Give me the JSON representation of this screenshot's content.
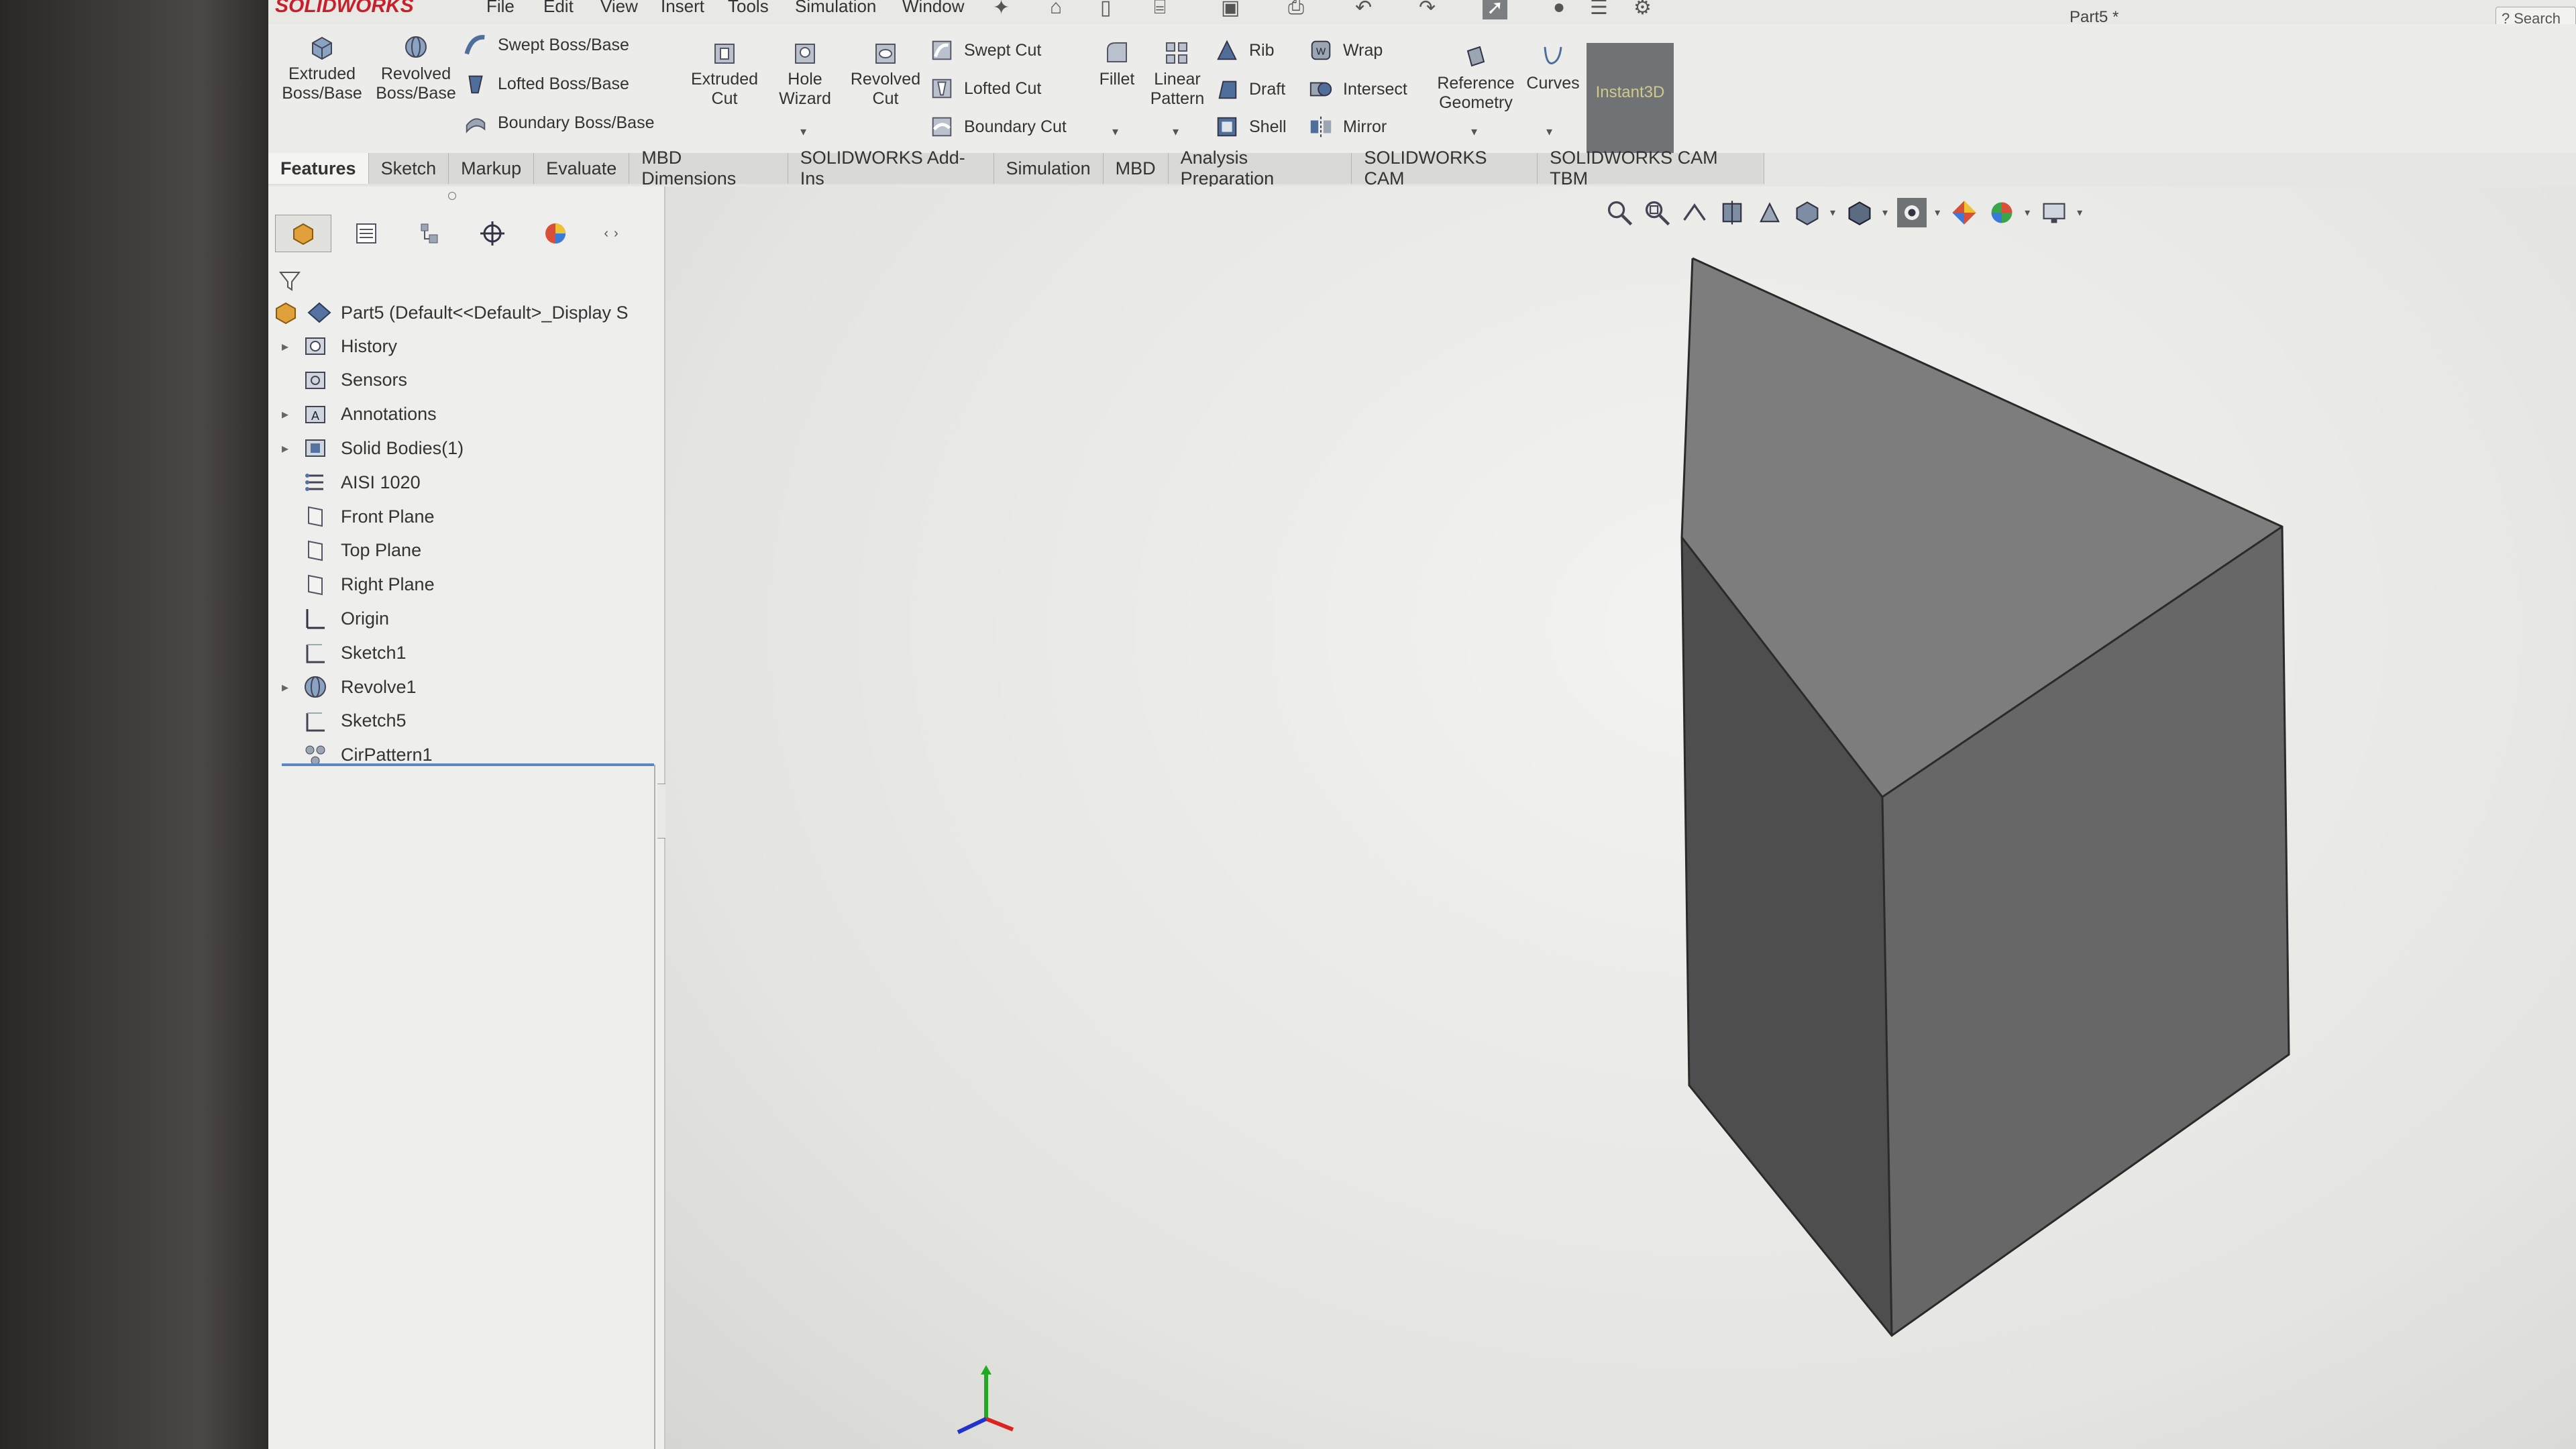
{
  "app": {
    "logo": "SOLIDWORKS",
    "document_title": "Part5 *",
    "search_label": "Search"
  },
  "menu": [
    "File",
    "Edit",
    "View",
    "Insert",
    "Tools",
    "Simulation",
    "Window"
  ],
  "ribbon": {
    "extruded_boss": "Extruded\nBoss/Base",
    "revolved_boss": "Revolved\nBoss/Base",
    "swept_boss": "Swept Boss/Base",
    "lofted_boss": "Lofted Boss/Base",
    "boundary_boss": "Boundary Boss/Base",
    "extruded_cut": "Extruded\nCut",
    "hole_wizard": "Hole\nWizard",
    "revolved_cut": "Revolved\nCut",
    "swept_cut": "Swept Cut",
    "lofted_cut": "Lofted Cut",
    "boundary_cut": "Boundary Cut",
    "fillet": "Fillet",
    "linear_pattern": "Linear\nPattern",
    "rib": "Rib",
    "draft": "Draft",
    "shell": "Shell",
    "wrap": "Wrap",
    "intersect": "Intersect",
    "mirror": "Mirror",
    "reference_geometry": "Reference\nGeometry",
    "curves": "Curves",
    "instant3d": "Instant3D"
  },
  "tabs": [
    {
      "label": "Features",
      "active": true
    },
    {
      "label": "Sketch",
      "active": false
    },
    {
      "label": "Markup",
      "active": false
    },
    {
      "label": "Evaluate",
      "active": false
    },
    {
      "label": "MBD Dimensions",
      "active": false
    },
    {
      "label": "SOLIDWORKS Add-Ins",
      "active": false
    },
    {
      "label": "Simulation",
      "active": false
    },
    {
      "label": "MBD",
      "active": false
    },
    {
      "label": "Analysis Preparation",
      "active": false
    },
    {
      "label": "SOLIDWORKS CAM",
      "active": false
    },
    {
      "label": "SOLIDWORKS CAM TBM",
      "active": false
    }
  ],
  "feature_tree": {
    "root": "Part5  (Default<<Default>_Display S",
    "items": [
      {
        "label": "History",
        "icon": "history-icon",
        "expandable": true
      },
      {
        "label": "Sensors",
        "icon": "sensors-icon",
        "expandable": false
      },
      {
        "label": "Annotations",
        "icon": "annotations-icon",
        "expandable": true
      },
      {
        "label": "Solid Bodies(1)",
        "icon": "solid-bodies-icon",
        "expandable": true
      },
      {
        "label": "AISI 1020",
        "icon": "material-icon",
        "expandable": false
      },
      {
        "label": "Front Plane",
        "icon": "plane-icon",
        "expandable": false
      },
      {
        "label": "Top Plane",
        "icon": "plane-icon",
        "expandable": false
      },
      {
        "label": "Right Plane",
        "icon": "plane-icon",
        "expandable": false
      },
      {
        "label": "Origin",
        "icon": "origin-icon",
        "expandable": false
      },
      {
        "label": "Sketch1",
        "icon": "sketch-icon",
        "expandable": false
      },
      {
        "label": "Revolve1",
        "icon": "revolve-icon",
        "expandable": true
      },
      {
        "label": "Sketch5",
        "icon": "sketch-icon",
        "expandable": false
      },
      {
        "label": "CirPattern1",
        "icon": "circular-pattern-icon",
        "expandable": false
      }
    ]
  },
  "colors": {
    "logo_red": "#c8202a",
    "cube_top": "#7d7d7d",
    "cube_left": "#4e4e4e",
    "cube_right": "#676767",
    "triad_x": "#d22",
    "triad_y": "#2a2",
    "triad_z": "#23c"
  }
}
